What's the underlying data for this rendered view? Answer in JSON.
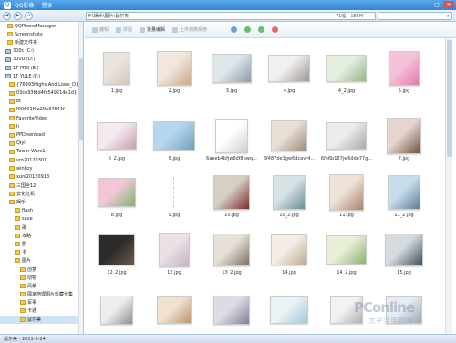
{
  "window": {
    "title": "QQ影像",
    "login": "登录",
    "controls": [
      "—",
      "□",
      "✕"
    ]
  },
  "nav": {
    "path": "F:\\娱乐\\图片\\鼠尔美",
    "info": "71幅，185M",
    "search_placeholder": ""
  },
  "toolbar": {
    "items": [
      {
        "label": "编辑",
        "icon": "edit-icon",
        "active": false
      },
      {
        "label": "拼图",
        "icon": "collage-icon",
        "active": false
      },
      {
        "label": "批量编辑",
        "icon": "batch-edit-icon",
        "active": true
      },
      {
        "label": "上传到微相册",
        "icon": "upload-icon",
        "active": false
      },
      {
        "label": "",
        "icon": "slideshow-icon",
        "active": false
      },
      {
        "label": "",
        "icon": "rotate-left-icon",
        "active": true
      },
      {
        "label": "",
        "icon": "rotate-right-icon",
        "active": true
      },
      {
        "label": "",
        "icon": "delete-icon",
        "active": true
      }
    ]
  },
  "sidebar": {
    "items": [
      {
        "label": "QQPhoneManager",
        "type": "folder"
      },
      {
        "label": "Screenshots",
        "type": "folder"
      },
      {
        "label": "新建文件夹",
        "type": "folder"
      },
      {
        "label": "300c (C:)",
        "type": "drive"
      },
      {
        "label": "300D (D:)",
        "type": "drive"
      },
      {
        "label": "1T PRO (E:)",
        "type": "drive"
      },
      {
        "label": "1T YULE (F:)",
        "type": "drive"
      },
      {
        "label": "{76993Highs And Lows_D}",
        "type": "folder"
      },
      {
        "label": "03ce93fdd4fc549214e1d}",
        "type": "folder"
      },
      {
        "label": "bt",
        "type": "folder"
      },
      {
        "label": "f00601f9a29a34641f",
        "type": "folder"
      },
      {
        "label": "FavoriteVideo",
        "type": "folder"
      },
      {
        "label": "h",
        "type": "folder"
      },
      {
        "label": "PPDownload",
        "type": "folder"
      },
      {
        "label": "Qiyi",
        "type": "folder"
      },
      {
        "label": "Tower Wars1",
        "type": "folder"
      },
      {
        "label": "vm20120301",
        "type": "folder"
      },
      {
        "label": "win8zy",
        "type": "folder"
      },
      {
        "label": "xuni20120913",
        "type": "folder"
      },
      {
        "label": "三国全12",
        "type": "folder"
      },
      {
        "label": "去化危机",
        "type": "folder"
      },
      {
        "label": "娱乐",
        "type": "folder"
      },
      {
        "label": "flash",
        "type": "folder"
      },
      {
        "label": "save",
        "type": "folder"
      },
      {
        "label": "歌",
        "type": "folder"
      },
      {
        "label": "攻略",
        "type": "folder"
      },
      {
        "label": "剧",
        "type": "folder"
      },
      {
        "label": "书",
        "type": "folder"
      },
      {
        "label": "图片",
        "type": "folder"
      },
      {
        "label": "创意",
        "type": "folder"
      },
      {
        "label": "动物",
        "type": "folder"
      },
      {
        "label": "风景",
        "type": "folder"
      },
      {
        "label": "國家地理图片珍藏全集",
        "type": "folder"
      },
      {
        "label": "军事",
        "type": "folder"
      },
      {
        "label": "卡通",
        "type": "folder"
      },
      {
        "label": "鼠尔美",
        "type": "folder",
        "selected": true
      }
    ]
  },
  "photos": [
    {
      "name": "1.jpg",
      "c": [
        "#e9e4de",
        "#d6c6b8"
      ]
    },
    {
      "name": "2.jpg",
      "c": [
        "#f1e7dd",
        "#c9a98c"
      ]
    },
    {
      "name": "3.jpg",
      "c": [
        "#dfe6ea",
        "#8c9aa6"
      ]
    },
    {
      "name": "4.jpg",
      "c": [
        "#f0f0ee",
        "#9d9590"
      ]
    },
    {
      "name": "4_2.jpg",
      "c": [
        "#e4efe0",
        "#9bb58a"
      ]
    },
    {
      "name": "5.jpg",
      "c": [
        "#f4c2d8",
        "#e07bb0"
      ]
    },
    {
      "name": "5_2.jpg",
      "c": [
        "#f3e9ee",
        "#c89fb2"
      ]
    },
    {
      "name": "6.jpg",
      "c": [
        "#b5d6ec",
        "#6f9fc0"
      ]
    },
    {
      "name": "6aeeb4bfjw6df8bwq...",
      "c": [
        "#ffffff",
        "#cfcfcf"
      ]
    },
    {
      "name": "6f487de3gw6dcavr4...",
      "c": [
        "#e8dfd6",
        "#9c8b7c"
      ]
    },
    {
      "name": "6fe6b187jw6dde77g...",
      "c": [
        "#ececec",
        "#a9a9a9"
      ]
    },
    {
      "name": "7.jpg",
      "c": [
        "#e6d6cf",
        "#704f3f"
      ]
    },
    {
      "name": "8.jpg",
      "c": [
        "#f2c6d6",
        "#7fb46b"
      ]
    },
    {
      "name": "9.jpg",
      "c": [
        "#ffffff",
        "#ffffff"
      ]
    },
    {
      "name": "10.jpg",
      "c": [
        "#d6cfc6",
        "#7a2f2b"
      ]
    },
    {
      "name": "10_2.jpg",
      "c": [
        "#d7e2e6",
        "#6b8d96"
      ]
    },
    {
      "name": "11.jpg",
      "c": [
        "#efe2d6",
        "#a7856b"
      ]
    },
    {
      "name": "11_2.jpg",
      "c": [
        "#c9dcea",
        "#5f7f99"
      ]
    },
    {
      "name": "12_2.jpg",
      "c": [
        "#2b2b2b",
        "#6d5a4c"
      ]
    },
    {
      "name": "12.jpg",
      "c": [
        "#eae0e6",
        "#c6b2c0"
      ]
    },
    {
      "name": "13_2.jpg",
      "c": [
        "#e5e0d8",
        "#7d6e5e"
      ]
    },
    {
      "name": "14.jpg",
      "c": [
        "#f3ede6",
        "#bfa98f"
      ]
    },
    {
      "name": "14_2.jpg",
      "c": [
        "#e7efd8",
        "#8bb36e"
      ]
    },
    {
      "name": "15.jpg",
      "c": [
        "#d6dbe0",
        "#3e4b57"
      ]
    },
    {
      "name": "",
      "c": [
        "#eeeeee",
        "#8f8f8f"
      ]
    },
    {
      "name": "",
      "c": [
        "#f0e2d2",
        "#b99672"
      ]
    },
    {
      "name": "",
      "c": [
        "#dcdce4",
        "#7f7f99"
      ]
    },
    {
      "name": "",
      "c": [
        "#eaf2f6",
        "#a6c7d6"
      ]
    },
    {
      "name": "",
      "c": [
        "#f2f2f2",
        "#b0b0b0"
      ]
    },
    {
      "name": "",
      "c": [
        "#e6ecf2",
        "#9aa9b9"
      ]
    }
  ],
  "status": {
    "text": "鼠尔美 - 2011-6-24"
  },
  "watermark": {
    "text": "PConline",
    "sub": "太平洋电脑网"
  }
}
